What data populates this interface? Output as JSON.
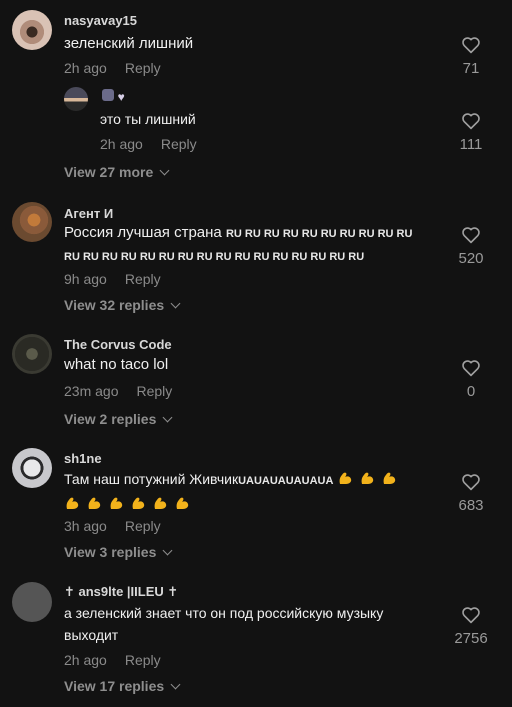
{
  "comments": [
    {
      "username": "nasyavay15",
      "text": "зеленский лишний",
      "time": "2h ago",
      "reply_label": "Reply",
      "likes": "71",
      "replies": [
        {
          "username_icons": "🧙🤍",
          "text": "это ты лишний",
          "time": "2h ago",
          "reply_label": "Reply",
          "likes": "111"
        }
      ],
      "view_more": "View 27 more"
    },
    {
      "username": "Агент И",
      "text_prefix": "Россия лучшая страна",
      "ru_token": "RU",
      "ru_count_line1": 10,
      "ru_count_line2": 16,
      "time": "9h ago",
      "reply_label": "Reply",
      "likes": "520",
      "view_more": "View 32 replies"
    },
    {
      "username": "The Corvus Code",
      "text": "what no taco lol",
      "time": "23m ago",
      "reply_label": "Reply",
      "likes": "0",
      "view_more": "View 2 replies"
    },
    {
      "username": "sh1ne",
      "text_prefix": "Там наш потужний Живчик",
      "text_suffix": "UAUAUAUAUAUA",
      "emoji_count_line1": 3,
      "emoji_count_line2": 6,
      "emoji_name": "flexed-biceps-icon",
      "time": "3h ago",
      "reply_label": "Reply",
      "likes": "683",
      "view_more": "View 3 replies"
    },
    {
      "username": "✝ ans9lte |IILEU ✝",
      "text_line1": "а зеленский знает что он под российскую музыку",
      "text_line2": "выходит",
      "time": "2h ago",
      "reply_label": "Reply",
      "likes": "2756",
      "view_more": "View 17 replies"
    }
  ],
  "colors": {
    "background": "#121212",
    "text": "#f0f0f0",
    "muted": "#8a8a8a",
    "emoji": "#f2b21b"
  }
}
